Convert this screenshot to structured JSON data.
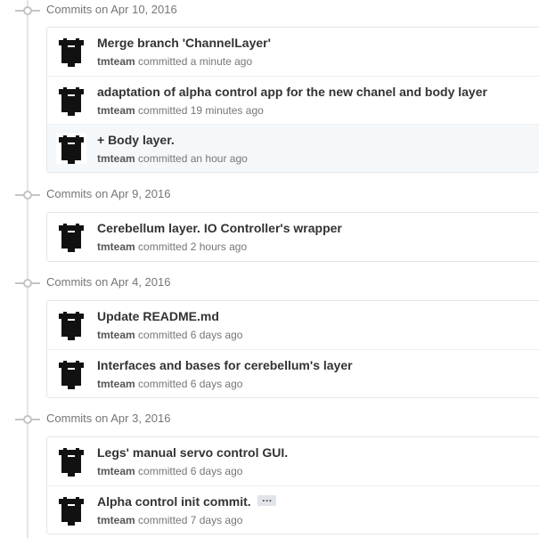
{
  "groups": [
    {
      "title": "Commits on Apr 10, 2016",
      "commits": [
        {
          "message": "Merge branch 'ChannelLayer'",
          "author": "tmteam",
          "verb": "committed",
          "time": "a minute ago"
        },
        {
          "message": "adaptation of alpha control app for the new chanel and body layer",
          "author": "tmteam",
          "verb": "committed",
          "time": "19 minutes ago"
        },
        {
          "message": "+ Body layer.",
          "author": "tmteam",
          "verb": "committed",
          "time": "an hour ago"
        }
      ]
    },
    {
      "title": "Commits on Apr 9, 2016",
      "commits": [
        {
          "message": "Cerebellum layer. IO Controller's wrapper",
          "author": "tmteam",
          "verb": "committed",
          "time": "2 hours ago"
        }
      ]
    },
    {
      "title": "Commits on Apr 4, 2016",
      "commits": [
        {
          "message": "Update README.md",
          "author": "tmteam",
          "verb": "committed",
          "time": "6 days ago"
        },
        {
          "message": "Interfaces and bases for cerebellum's layer",
          "author": "tmteam",
          "verb": "committed",
          "time": "6 days ago"
        }
      ]
    },
    {
      "title": "Commits on Apr 3, 2016",
      "commits": [
        {
          "message": "Legs' manual servo control GUI.",
          "author": "tmteam",
          "verb": "committed",
          "time": "6 days ago"
        },
        {
          "message": "Alpha control init commit.",
          "author": "tmteam",
          "verb": "committed",
          "time": "7 days ago",
          "expand_label": "…"
        }
      ]
    }
  ],
  "icons": {
    "commit_node": "git-commit-icon",
    "avatar": "tmteam-avatar",
    "expand": "ellipsis-icon"
  },
  "colors": {
    "text_primary": "#333333",
    "text_muted": "#767676",
    "border": "#e5e5e5",
    "highlight_row": "#f5f8fa",
    "timeline": "#e4e4e4"
  }
}
